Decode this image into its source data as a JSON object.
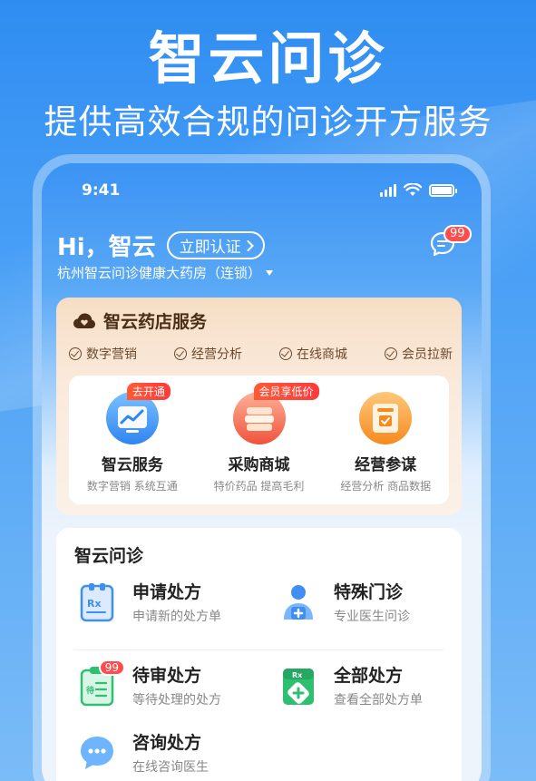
{
  "promo": {
    "headline": "智云问诊",
    "subline": "提供高效合规的问诊开方服务"
  },
  "status_bar": {
    "time": "9:41"
  },
  "header": {
    "greeting": "Hi，智云",
    "verify_label": "立即认证",
    "store_name": "杭州智云问诊健康大药房（连锁）",
    "message_badge": "99"
  },
  "pharmacy": {
    "title": "智云药店服务",
    "tags": [
      "数字营销",
      "经营分析",
      "在线商城",
      "会员拉新"
    ],
    "services": [
      {
        "name": "智云服务",
        "desc": "数字营销 系统互通",
        "badge": "去开通",
        "icon": "chart-screen-icon"
      },
      {
        "name": "采购商城",
        "desc": "特价药品 提高毛利",
        "badge": "会员享低价",
        "icon": "stacked-goods-icon"
      },
      {
        "name": "经营参谋",
        "desc": "经营分析 商品数据",
        "badge": "",
        "icon": "data-board-icon"
      }
    ]
  },
  "consult": {
    "title": "智云问诊",
    "items": [
      {
        "name": "申请处方",
        "desc": "申请新的处方单",
        "icon": "rx-clipboard-icon"
      },
      {
        "name": "特殊门诊",
        "desc": "专业医生问诊",
        "icon": "doctor-icon"
      },
      {
        "name": "待审处方",
        "desc": "等待处理的处方",
        "icon": "pending-clipboard-icon",
        "badge": "99"
      },
      {
        "name": "全部处方",
        "desc": "查看全部处方单",
        "icon": "rx-box-icon"
      },
      {
        "name": "咨询处方",
        "desc": "在线咨询医生",
        "icon": "chat-bubble-icon"
      }
    ]
  },
  "colors": {
    "brand_blue": "#2f8df2",
    "badge_red": "#ff4d4f",
    "pharmacy_brown": "#4a2e17",
    "consult_green": "#2fbf71"
  }
}
